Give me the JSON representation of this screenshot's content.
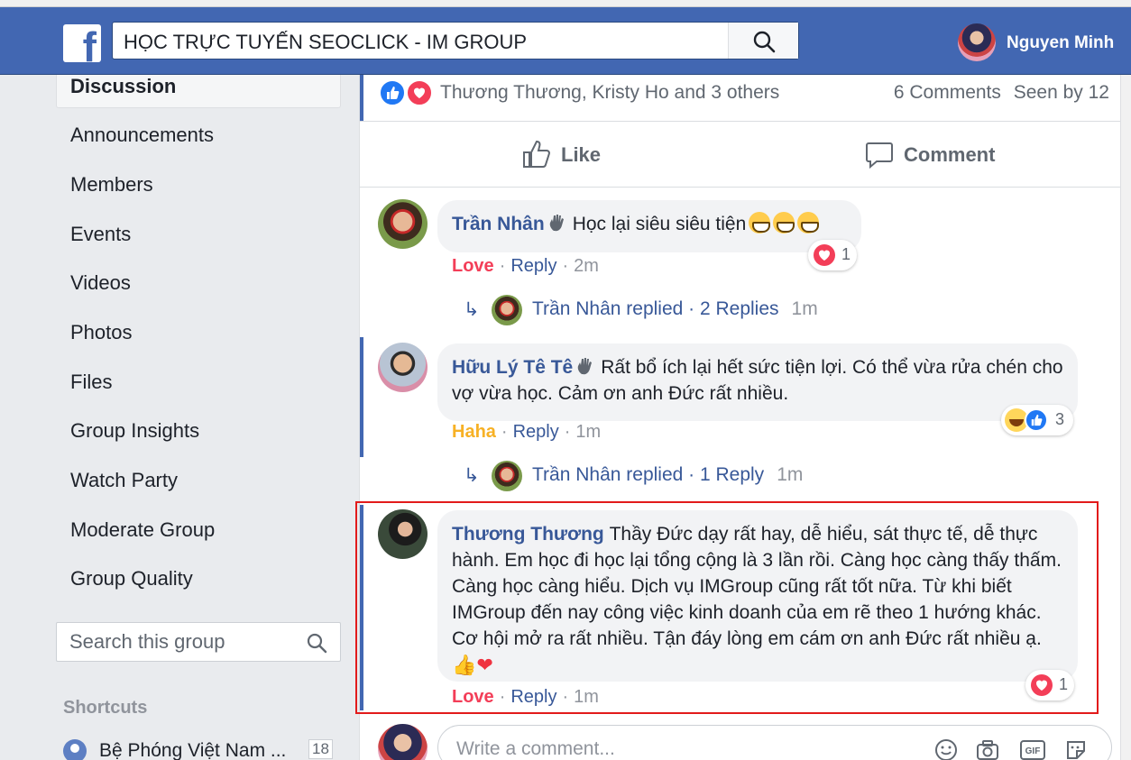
{
  "header": {
    "search_value": "HỌC TRỰC TUYẾN SEOCLICK - IM GROUP",
    "user_name": "Nguyen Minh"
  },
  "sidebar": {
    "active": "Discussion",
    "items": [
      "Announcements",
      "Members",
      "Events",
      "Videos",
      "Photos",
      "Files",
      "Group Insights",
      "Watch Party",
      "Moderate Group",
      "Group Quality"
    ],
    "search_placeholder": "Search this group",
    "shortcuts_title": "Shortcuts",
    "shortcut": {
      "label": "Bệ Phóng Việt Nam ...",
      "count": "18"
    }
  },
  "post": {
    "reactors": "Thương Thương, Kristy Ho and 3 others",
    "comments_count": "6 Comments",
    "seen_by": "Seen by 12",
    "like_label": "Like",
    "comment_label": "Comment"
  },
  "comments": [
    {
      "author": "Trần Nhân",
      "text": "Học lại siêu siêu tiện",
      "reaction_label": "Love",
      "reply_label": "Reply",
      "time": "2m",
      "reaction_count": "1",
      "replied": "Trần Nhân replied · 2 Replies",
      "replied_time": "1m"
    },
    {
      "author": "Hữu Lý Tê Tê",
      "text": "Rất bổ ích lại hết sức tiện lợi. Có thể vừa rửa chén cho vợ vừa học. Cảm ơn anh Đức rất nhiều.",
      "reaction_label": "Haha",
      "reply_label": "Reply",
      "time": "1m",
      "reaction_count": "3",
      "replied": "Trần Nhân replied · 1 Reply",
      "replied_time": "1m"
    },
    {
      "author": "Thương Thương",
      "text": "Thầy Đức dạy rất hay, dễ hiểu, sát thực tế, dễ thực hành. Em học đi học lại tổng cộng là 3 lần rồi. Càng học càng thấy thấm. Càng học càng hiểu. Dịch vụ IMGroup cũng rất tốt nữa. Từ khi biết IMGroup đến nay công việc kinh doanh của em rẽ theo 1 hướng khác. Cơ hội mở ra rất nhiều. Tận đáy lòng em cám ơn anh Đức rất nhiều ạ.",
      "reaction_label": "Love",
      "reply_label": "Reply",
      "time": "1m",
      "reaction_count": "1"
    }
  ],
  "composer": {
    "placeholder": "Write a comment..."
  },
  "colors": {
    "brand": "#4267b2",
    "link": "#385898",
    "love": "#f33e58",
    "haha": "#f7b125",
    "highlight": "#e21b1b"
  }
}
